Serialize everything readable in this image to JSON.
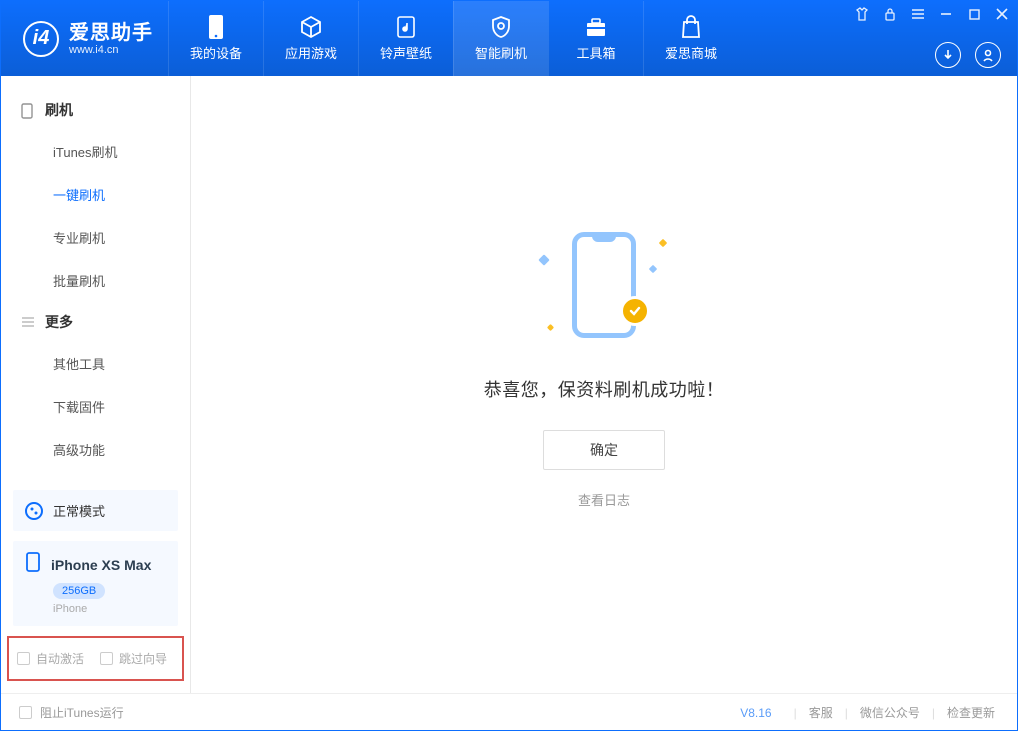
{
  "app": {
    "title": "爱思助手",
    "url": "www.i4.cn"
  },
  "nav": {
    "items": [
      {
        "label": "我的设备"
      },
      {
        "label": "应用游戏"
      },
      {
        "label": "铃声壁纸"
      },
      {
        "label": "智能刷机"
      },
      {
        "label": "工具箱"
      },
      {
        "label": "爱思商城"
      }
    ]
  },
  "sidebar": {
    "group_flash": "刷机",
    "flash_items": [
      "iTunes刷机",
      "一键刷机",
      "专业刷机",
      "批量刷机"
    ],
    "group_more": "更多",
    "more_items": [
      "其他工具",
      "下载固件",
      "高级功能"
    ],
    "mode_label": "正常模式",
    "device": {
      "name": "iPhone XS Max",
      "storage": "256GB",
      "type": "iPhone"
    },
    "opt_auto_activate": "自动激活",
    "opt_skip_guide": "跳过向导"
  },
  "main": {
    "success": "恭喜您，保资料刷机成功啦！",
    "ok": "确定",
    "view_log": "查看日志"
  },
  "footer": {
    "block_itunes": "阻止iTunes运行",
    "version": "V8.16",
    "support": "客服",
    "wechat": "微信公众号",
    "update": "检查更新"
  }
}
